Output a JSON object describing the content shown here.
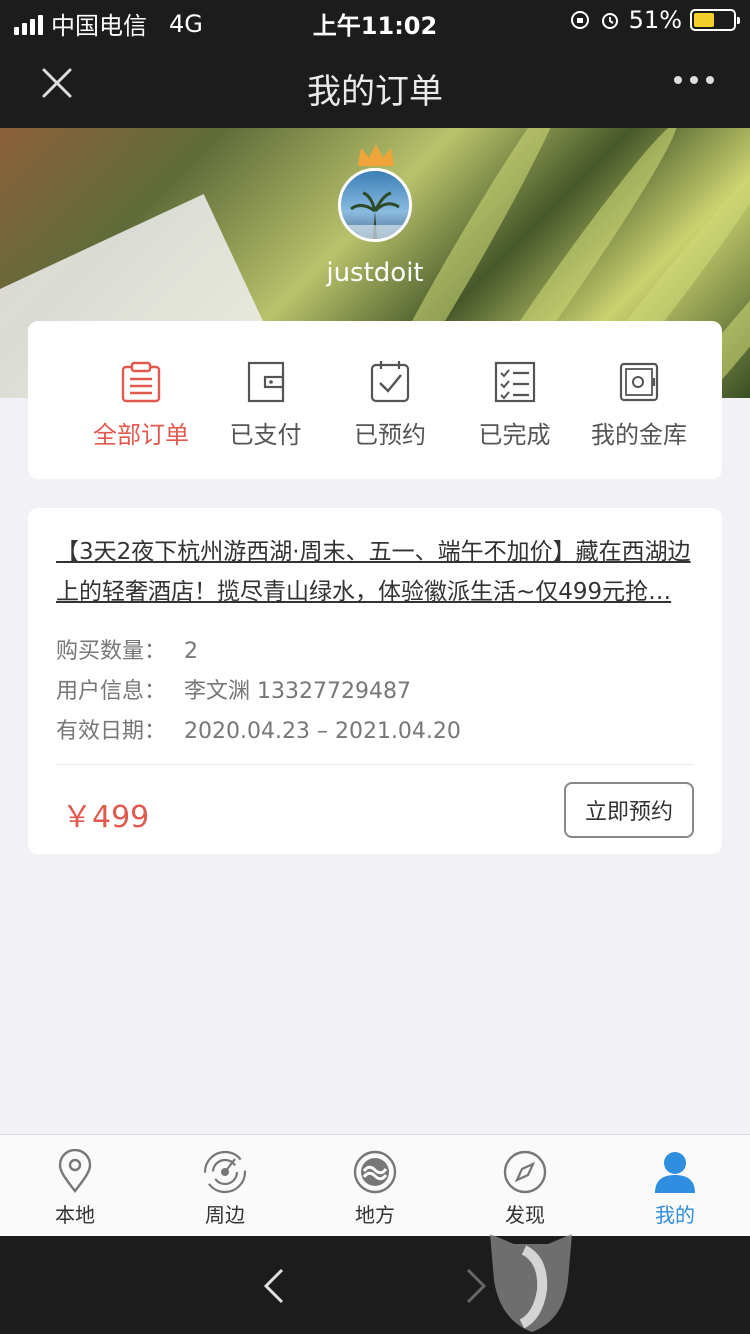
{
  "status_bar": {
    "carrier": "中国电信",
    "network": "4G",
    "time": "上午11:02",
    "battery": "51%"
  },
  "nav": {
    "title": "我的订单"
  },
  "profile": {
    "username": "justdoit"
  },
  "order_tabs": [
    {
      "label": "全部订单",
      "icon": "clipboard-icon",
      "active": true
    },
    {
      "label": "已支付",
      "icon": "wallet-icon",
      "active": false
    },
    {
      "label": "已预约",
      "icon": "calendar-check-icon",
      "active": false
    },
    {
      "label": "已完成",
      "icon": "checklist-icon",
      "active": false
    },
    {
      "label": "我的金库",
      "icon": "safe-icon",
      "active": false
    }
  ],
  "order": {
    "title": "【3天2夜下杭州游西湖·周末、五一、端午不加价】藏在西湖边上的轻奢酒店！揽尽青山绿水，体验徽派生活~仅499元抢…",
    "quantity_label": "购买数量：",
    "quantity": "2",
    "user_label": "用户信息：",
    "user": "李文渊 13327729487",
    "date_label": "有效日期：",
    "date": "2020.04.23 – 2021.04.20",
    "price": "￥499",
    "book_button": "立即预约"
  },
  "tab_bar": [
    {
      "label": "本地",
      "icon": "location-pin-icon",
      "active": false
    },
    {
      "label": "周边",
      "icon": "radar-icon",
      "active": false
    },
    {
      "label": "地方",
      "icon": "wave-circle-icon",
      "active": false
    },
    {
      "label": "发现",
      "icon": "compass-icon",
      "active": false
    },
    {
      "label": "我的",
      "icon": "user-icon",
      "active": true
    }
  ],
  "colors": {
    "accent_red": "#e25a4f",
    "active_blue": "#2f8ee0",
    "dark_bar": "#1c1c1c",
    "page_bg": "#f2f1f6"
  }
}
